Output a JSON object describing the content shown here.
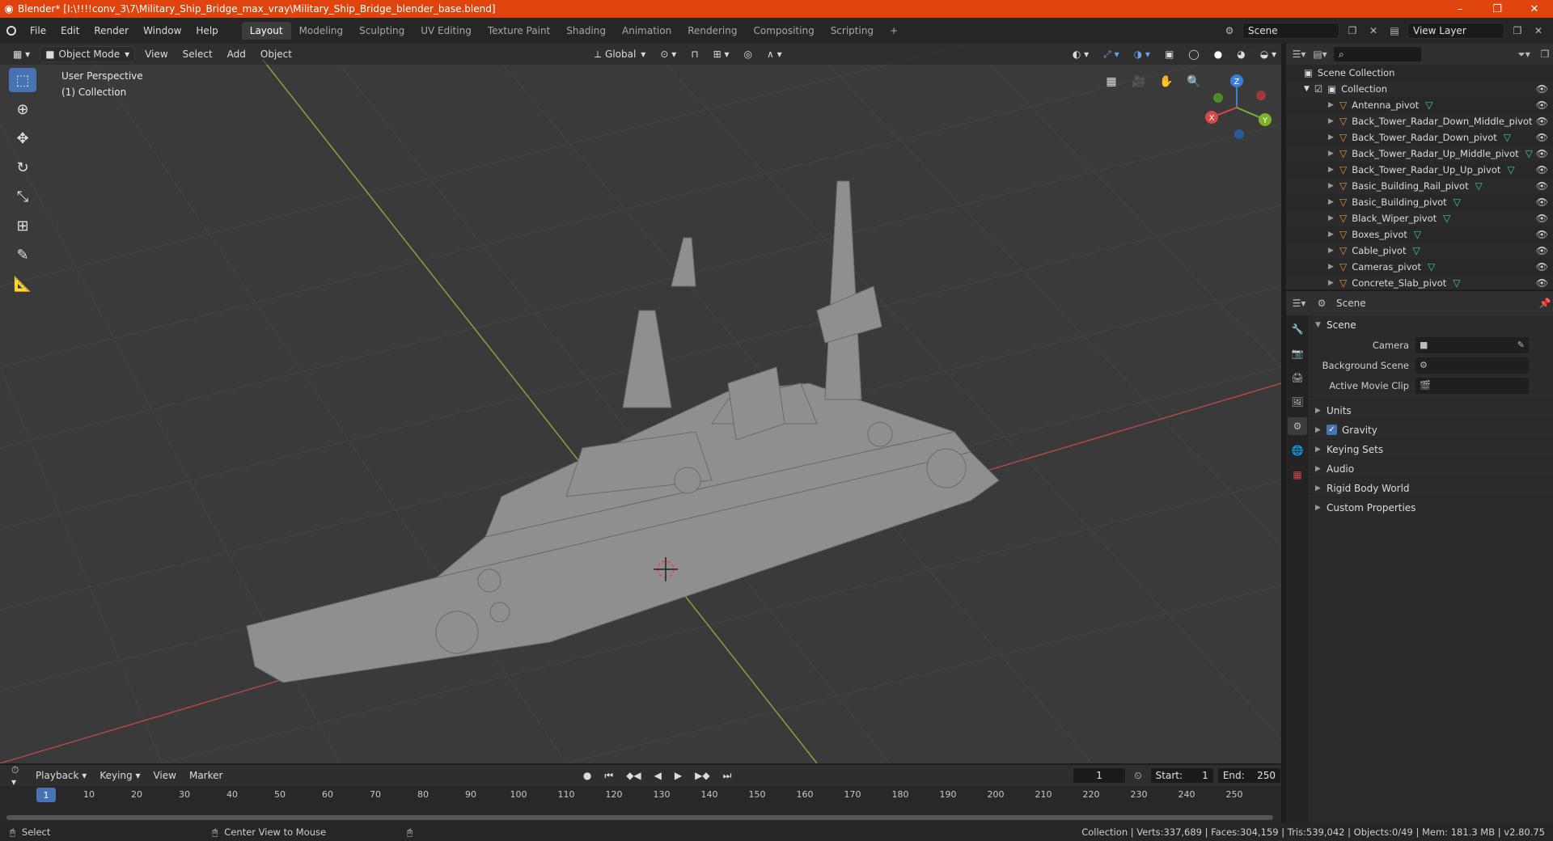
{
  "window": {
    "title": "Blender* [I:\\!!!!conv_3\\7\\Military_Ship_Bridge_max_vray\\Military_Ship_Bridge_blender_base.blend]",
    "minimize": "–",
    "restore": "❐",
    "close": "✕"
  },
  "menu": [
    "File",
    "Edit",
    "Render",
    "Window",
    "Help"
  ],
  "workspaces": [
    {
      "label": "Layout",
      "active": true
    },
    {
      "label": "Modeling"
    },
    {
      "label": "Sculpting"
    },
    {
      "label": "UV Editing"
    },
    {
      "label": "Texture Paint"
    },
    {
      "label": "Shading"
    },
    {
      "label": "Animation"
    },
    {
      "label": "Rendering"
    },
    {
      "label": "Compositing"
    },
    {
      "label": "Scripting"
    }
  ],
  "add_workspace": "+",
  "scene_selector": "Scene",
  "view_layer": "View Layer",
  "viewport": {
    "mode": "Object Mode",
    "menus": [
      "View",
      "Select",
      "Add",
      "Object"
    ],
    "orientation": "Global",
    "info_line1": "User Perspective",
    "info_line2": "(1) Collection",
    "gizmo": {
      "x": "X",
      "y": "Y",
      "z": "Z"
    }
  },
  "outliner": {
    "root": "Scene Collection",
    "collection": "Collection",
    "items": [
      "Antenna_pivot",
      "Back_Tower_Radar_Down_Middle_pivot",
      "Back_Tower_Radar_Down_pivot",
      "Back_Tower_Radar_Up_Middle_pivot",
      "Back_Tower_Radar_Up_Up_pivot",
      "Basic_Building_Rail_pivot",
      "Basic_Building_pivot",
      "Black_Wiper_pivot",
      "Boxes_pivot",
      "Cable_pivot",
      "Cameras_pivot",
      "Concrete_Slab_pivot"
    ]
  },
  "properties": {
    "context": "Scene",
    "panel": "Scene",
    "fields": [
      {
        "label": "Camera"
      },
      {
        "label": "Background Scene"
      },
      {
        "label": "Active Movie Clip"
      }
    ],
    "subpanels": [
      "Units",
      "Gravity",
      "Keying Sets",
      "Audio",
      "Rigid Body World",
      "Custom Properties"
    ]
  },
  "timeline": {
    "menus": [
      "Playback",
      "Keying",
      "View",
      "Marker"
    ],
    "current_frame": "1",
    "start_label": "Start:",
    "start": "1",
    "end_label": "End:",
    "end": "250",
    "ruler": [
      "10",
      "20",
      "30",
      "40",
      "50",
      "60",
      "70",
      "80",
      "90",
      "100",
      "110",
      "120",
      "130",
      "140",
      "150",
      "160",
      "170",
      "180",
      "190",
      "200",
      "210",
      "220",
      "230",
      "240",
      "250"
    ]
  },
  "status": {
    "left": "Select",
    "middle": "Center View to Mouse",
    "right": "Collection | Verts:337,689 | Faces:304,159 | Tris:539,042 | Objects:0/49 | Mem: 181.3 MB | v2.80.75"
  }
}
